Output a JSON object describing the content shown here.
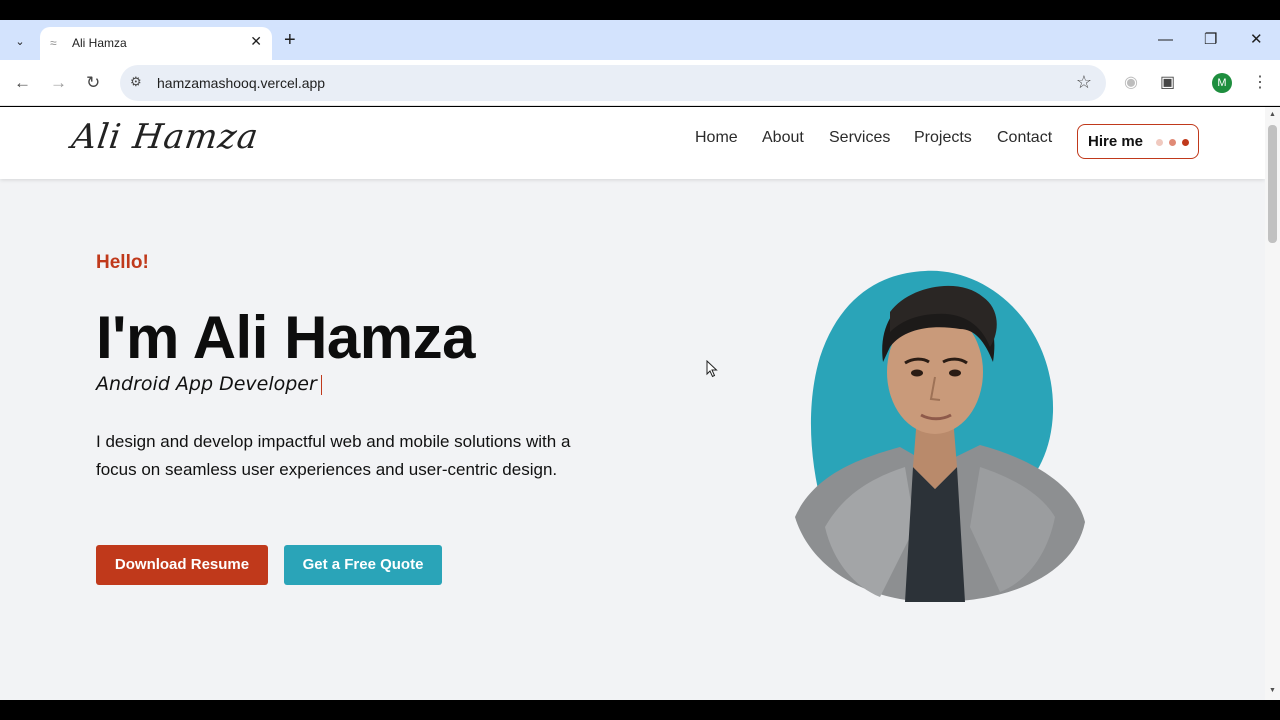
{
  "browser": {
    "tab_title": "Ali Hamza",
    "url": "hamzamashooq.vercel.app",
    "profile_initial": "M",
    "icons": [
      "tab-search-icon",
      "favicon-icon",
      "close-icon",
      "plus-icon",
      "minimize-icon",
      "restore-icon",
      "close-window-icon",
      "back-icon",
      "forward-icon",
      "reload-icon",
      "site-info-icon",
      "star-icon",
      "extension-icon",
      "puzzle-icon",
      "menu-icon"
    ]
  },
  "site": {
    "logo": "Ali Hamza",
    "nav": [
      "Home",
      "About",
      "Services",
      "Projects",
      "Contact"
    ],
    "hire_label": "Hire me"
  },
  "hero": {
    "greeting": "Hello!",
    "name": "I'm Ali Hamza",
    "role": "Android App Developer",
    "description": "I design and develop impactful web and mobile solutions with a focus on seamless user experiences and user-centric design.",
    "btn_resume": "Download Resume",
    "btn_quote": "Get a Free Quote"
  },
  "colors": {
    "accent": "#c0391b",
    "teal": "#2aa4b8"
  }
}
